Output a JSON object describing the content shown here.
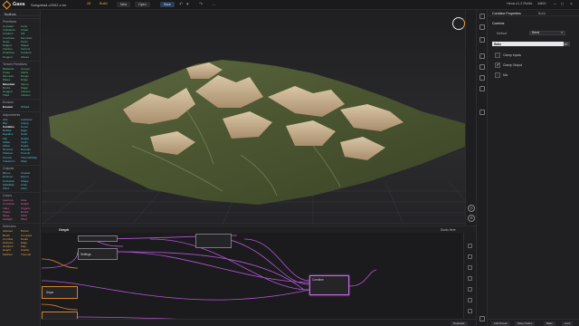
{
  "topbar": {
    "app_name": "Gaea",
    "file_name": "Sangabad-v2002-c.tor",
    "menu_items": [
      "28",
      "Build",
      "New",
      "Open",
      "Save"
    ],
    "build_label": "Build",
    "right_label": "Hexa-v1.2 RuMe",
    "user": "4/800"
  },
  "toolbox": {
    "title": "Toolbox",
    "sections": [
      {
        "name": "Primitives",
        "color": "green",
        "items": [
          "Constant",
          "Cone",
          "Cellularize",
          "Crater",
          "Gradient",
          "Hill",
          "LineNoise",
          "Mountain",
          "Noise",
          "Perlin",
          "Ridged",
          "Shape",
          "Volcano",
          "Voronoi",
          "DripNoise",
          "Gradient",
          "Rugged",
          "Waves"
        ]
      },
      {
        "name": "Terrain Primitives",
        "color": "green",
        "items": [
          "Badlands",
          "Canyon",
          "Crater",
          "Island",
          "Mountain",
          "Range",
          "Plates",
          "Ridge",
          "Mountain",
          "Slump",
          "Rocks",
          "Stage",
          "Rugged",
          "Volcano",
          "Tilted",
          "Volcano"
        ]
      },
      {
        "name": "Erosion",
        "color": "cyan",
        "items": [
          "Erosion",
          "Wizard"
        ]
      },
      {
        "name": "Adjustments",
        "color": "cyan",
        "items": [
          "Aba",
          "Autolevel",
          "Blur",
          "Clamp",
          "Combine",
          "Curve",
          "Deflate",
          "Edge",
          "Equalize",
          "Grain",
          "Flip",
          "Height",
          "Inflate",
          "Invert",
          "Offset",
          "Peaks",
          "Recurve",
          "Rescale",
          "Sharpen",
          "Smooth",
          "Terrace",
          "ThermalShaper",
          "Transform",
          "Warp"
        ]
      },
      {
        "name": "Outputs",
        "color": "cyan",
        "items": [
          "Biome",
          "Cracker",
          "Detector",
          "Export",
          "Occlusion",
          "Shape",
          "SplatMap",
          "Unity",
          "Wind",
          "Zone"
        ]
      },
      {
        "name": "Colors",
        "color": "pink",
        "items": [
          "Aperture",
          "Area",
          "Curvature",
          "Height",
          "Index",
          "Organic",
          "Peaks",
          "Rocky",
          "Slope",
          "Solid",
          "Sunlight",
          "Wind"
        ]
      },
      {
        "name": "Selectors",
        "color": "orange",
        "items": [
          "Abstract",
          "Border",
          "Brush",
          "Compare",
          "Crumble",
          "Detail",
          "Distance",
          "Edge",
          "Gradient",
          "Map",
          "Height",
          "Scatter",
          "MultiSel",
          "Thermal"
        ]
      }
    ]
  },
  "graph": {
    "title": "Graph",
    "dock_label": "Docks Here",
    "nodes": [
      {
        "label": "",
        "type": "plain"
      },
      {
        "label": "Settings",
        "type": "plain"
      },
      {
        "label": "",
        "type": "plain"
      },
      {
        "label": "Combine",
        "type": "selected"
      },
      {
        "label": "Slope",
        "type": "orange"
      },
      {
        "label": "",
        "type": "orange"
      }
    ],
    "bottom_buttons": [
      "Duplicate",
      "Full Screen",
      "Save Nodes",
      "Build",
      "Lock"
    ]
  },
  "props": {
    "tabs": [
      "Combine Properties",
      "Build"
    ],
    "node_name": "Combine",
    "method_label": "Method",
    "method_value": "Blend",
    "ratio_label": "Ratio",
    "ratio_value": "1.00",
    "ratio_fraction": 0.92,
    "checks": [
      {
        "label": "Clamp Inputs",
        "checked": false
      },
      {
        "label": "Clamp Output",
        "checked": true
      },
      {
        "label": "Mix",
        "checked": false
      }
    ],
    "footer_left": "Permanent",
    "footer_right": [
      "Reset",
      "Defaults"
    ],
    "bottom_buttons": [
      "Bake",
      "Lock"
    ]
  },
  "colors": {
    "accent": "#f0a030",
    "selection": "#c56ae0",
    "wire": "#b455d6",
    "terrain_base": "#4e5a33",
    "terrain_rock": "#d9c1a0"
  }
}
